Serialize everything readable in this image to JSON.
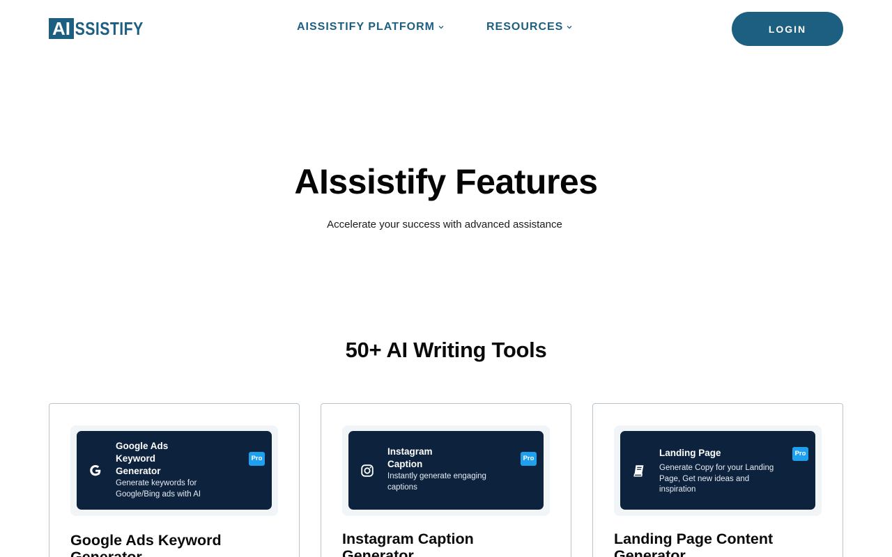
{
  "header": {
    "logo": {
      "box_text": "AI",
      "rest_text": "SSISTIFY"
    },
    "nav": [
      {
        "label": "AISSISTIFY PLATFORM"
      },
      {
        "label": "RESOURCES"
      }
    ],
    "login_label": "LOGIN"
  },
  "hero": {
    "title": "AIssistify Features",
    "subtitle": "Accelerate your success with advanced assistance"
  },
  "tools": {
    "title": "50+ AI Writing Tools",
    "cards": [
      {
        "thumb_title_lines": [
          "Google Ads",
          "Keyword",
          "Generator"
        ],
        "thumb_desc_lines": [
          "Generate keywords for",
          "Google/Bing ads with AI"
        ],
        "badge": "Pro",
        "icon": "google-icon",
        "title": "Google Ads Keyword Generator"
      },
      {
        "thumb_title_lines": [
          "Instagram",
          "Caption"
        ],
        "thumb_desc_lines": [
          "Instantly generate engaging",
          "captions"
        ],
        "badge": "Pro",
        "icon": "instagram-icon",
        "title": "Instagram Caption Generator"
      },
      {
        "thumb_title_lines": [
          "Landing Page"
        ],
        "thumb_desc_lines": [
          "Generate Copy for your Landing",
          "Page, Get new ideas and",
          "inspiration"
        ],
        "badge": "Pro",
        "icon": "book-icon",
        "title": "Landing Page Content Generator"
      }
    ]
  },
  "colors": {
    "brand": "#1d5f80",
    "card_dark": "#0d223d",
    "pro_badge": "#1fa0ee"
  }
}
